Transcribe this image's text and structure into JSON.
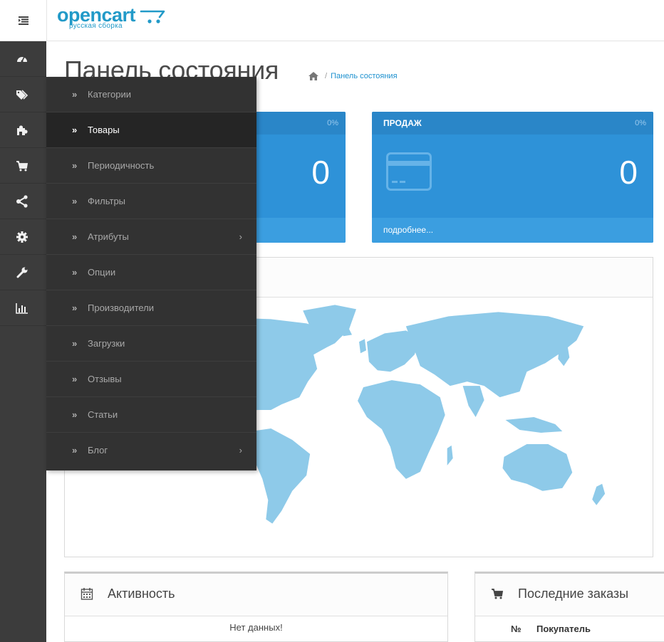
{
  "header": {
    "logo_text": "opencart",
    "logo_sub": "русская сборка"
  },
  "sidebar": {
    "items": [
      {
        "icon": "dashboard-icon"
      },
      {
        "icon": "tags-icon"
      },
      {
        "icon": "puzzle-icon"
      },
      {
        "icon": "cart-icon"
      },
      {
        "icon": "share-icon"
      },
      {
        "icon": "gear-icon"
      },
      {
        "icon": "wrench-icon"
      },
      {
        "icon": "bar-chart-icon"
      }
    ]
  },
  "page": {
    "title": "Панель состояния",
    "breadcrumb_sep": "/",
    "breadcrumb_link": "Панель состояния"
  },
  "tiles": [
    {
      "title": "",
      "percent": "0%",
      "value": "0",
      "link": ""
    },
    {
      "title": "ПРОДАЖ",
      "percent": "0%",
      "value": "0",
      "link": "подробнее..."
    }
  ],
  "activity": {
    "title": "Активность",
    "empty": "Нет данных!"
  },
  "orders": {
    "title": "Последние заказы",
    "columns": [
      "№",
      "Покупатель"
    ]
  },
  "flyout": {
    "items": [
      {
        "chev": "»",
        "label": "Категории",
        "active": false,
        "has_submenu": false
      },
      {
        "chev": "»",
        "label": "Товары",
        "active": true,
        "has_submenu": false
      },
      {
        "chev": "»",
        "label": "Периодичность",
        "active": false,
        "has_submenu": false
      },
      {
        "chev": "»",
        "label": "Фильтры",
        "active": false,
        "has_submenu": false
      },
      {
        "chev": "»",
        "label": "Атрибуты",
        "active": false,
        "has_submenu": true
      },
      {
        "chev": "»",
        "label": "Опции",
        "active": false,
        "has_submenu": false
      },
      {
        "chev": "»",
        "label": "Производители",
        "active": false,
        "has_submenu": false
      },
      {
        "chev": "»",
        "label": "Загрузки",
        "active": false,
        "has_submenu": false
      },
      {
        "chev": "»",
        "label": "Отзывы",
        "active": false,
        "has_submenu": false
      },
      {
        "chev": "»",
        "label": "Статьи",
        "active": false,
        "has_submenu": false
      },
      {
        "chev": "»",
        "label": "Блог",
        "active": false,
        "has_submenu": true
      }
    ],
    "submenu_arrow": "›"
  },
  "colors": {
    "brand": "#229ac8",
    "tile_bg": "#2e92d8",
    "sidebar_bg": "#3c3c3c",
    "flyout_bg": "#323232",
    "map_land": "#8ecae9"
  }
}
